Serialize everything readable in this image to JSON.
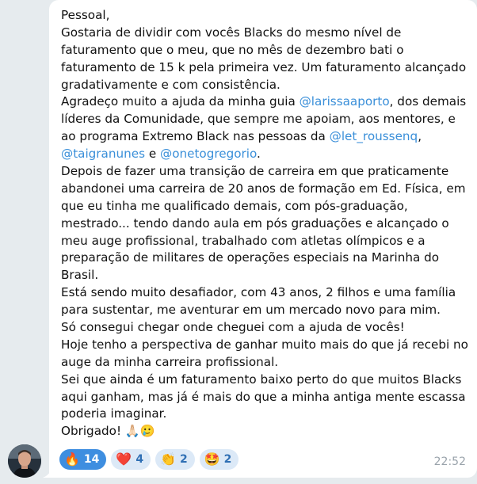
{
  "message": {
    "lines": [
      [
        {
          "t": "Pessoal,"
        }
      ],
      [
        {
          "t": "Gostaria de dividir com vocês Blacks do mesmo nível de"
        }
      ],
      [
        {
          "t": "faturamento que o meu, que no mês de dezembro bati o"
        }
      ],
      [
        {
          "t": "faturamento de 15 k pela primeira vez. Um faturamento alcançado"
        }
      ],
      [
        {
          "t": "gradativamente e com consistência."
        }
      ],
      [
        {
          "t": "Agradeço muito a ajuda da minha guia "
        },
        {
          "t": "@larissaaporto",
          "mention": true
        },
        {
          "t": ", dos demais"
        }
      ],
      [
        {
          "t": "líderes da Comunidade, que sempre me apoiam, aos mentores, e"
        }
      ],
      [
        {
          "t": "ao programa Extremo Black nas pessoas da "
        },
        {
          "t": "@let_roussenq",
          "mention": true
        },
        {
          "t": ","
        }
      ],
      [
        {
          "t": "@taigranunes",
          "mention": true
        },
        {
          "t": " e "
        },
        {
          "t": "@onetogregorio",
          "mention": true
        },
        {
          "t": "."
        }
      ],
      [
        {
          "t": "Depois de fazer uma transição de carreira em que praticamente"
        }
      ],
      [
        {
          "t": "abandonei uma carreira de 20 anos de formação em Ed. Física, em"
        }
      ],
      [
        {
          "t": "que eu tinha me qualificado demais, com pós-graduação,"
        }
      ],
      [
        {
          "t": "mestrado... tendo dando aula em pós graduações e alcançado o"
        }
      ],
      [
        {
          "t": "meu auge profissional, trabalhado com atletas olímpicos e a"
        }
      ],
      [
        {
          "t": "preparação de militares de operações especiais na Marinha do"
        }
      ],
      [
        {
          "t": "Brasil."
        }
      ],
      [
        {
          "t": "Está sendo muito desafiador, com 43 anos, 2 filhos e uma família"
        }
      ],
      [
        {
          "t": "para sustentar, me aventurar em um mercado novo para mim."
        }
      ],
      [
        {
          "t": "Só consegui chegar onde cheguei com a ajuda de vocês!"
        }
      ],
      [
        {
          "t": "Hoje tenho a perspectiva de ganhar muito mais do que já recebi no"
        }
      ],
      [
        {
          "t": "auge da minha carreira profissional."
        }
      ],
      [
        {
          "t": "Sei que ainda é um faturamento baixo perto do que muitos Blacks"
        }
      ],
      [
        {
          "t": "aqui ganham, mas já é mais do que a minha antiga mente escassa"
        }
      ],
      [
        {
          "t": "poderia imaginar."
        }
      ],
      [
        {
          "t": "Obrigado! 🙏🏻🥲"
        }
      ]
    ],
    "timestamp": "22:52"
  },
  "reactions": [
    {
      "emoji": "🔥",
      "count": "14",
      "icon": "fire-icon",
      "active": true
    },
    {
      "emoji": "❤️",
      "count": "4",
      "icon": "heart-icon",
      "active": false
    },
    {
      "emoji": "👏",
      "count": "2",
      "icon": "clapping-hands-icon",
      "active": false
    },
    {
      "emoji": "🤩",
      "count": "2",
      "icon": "star-struck-icon",
      "active": false
    }
  ],
  "colors": {
    "background": "#e6ebee",
    "bubble": "#ffffff",
    "mention": "#3a8fd9",
    "reaction_active": "#3e8ee0",
    "reaction_inactive": "#dce9f7"
  }
}
